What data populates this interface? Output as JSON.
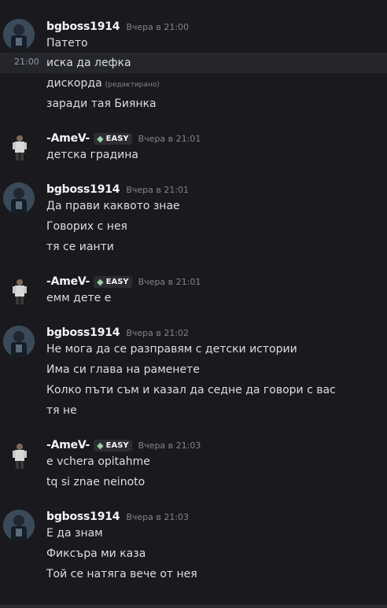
{
  "messages": [
    {
      "user": "bgboss1914",
      "time": "Вчера в 21:00",
      "lines": [
        "Патето",
        "иска да лефка",
        "дискорда",
        "заради тая Биянка"
      ],
      "edited_label": "(редактирано)"
    },
    {
      "user": "-AmeV-",
      "tag": "EASY",
      "time": "Вчера в 21:01",
      "lines": [
        "детска градина"
      ]
    },
    {
      "user": "bgboss1914",
      "time": "Вчера в 21:01",
      "lines": [
        "Да прави каквото знае",
        "Говорих с нея",
        "тя се ианти"
      ]
    },
    {
      "user": "-AmeV-",
      "tag": "EASY",
      "time": "Вчера в 21:01",
      "lines": [
        "емм дете е"
      ]
    },
    {
      "user": "bgboss1914",
      "time": "Вчера в 21:02",
      "lines": [
        "Не мога да се разправям с детски истории",
        "Има си глава на раменете",
        "Колко пъти съм и казал да седне да говори с вас",
        "тя не"
      ]
    },
    {
      "user": "-AmeV-",
      "tag": "EASY",
      "time": "Вчера в 21:03",
      "lines": [
        "e vchera opitahme",
        "tq si znae neinoto"
      ]
    },
    {
      "user": "bgboss1914",
      "time": "Вчера в 21:03",
      "lines": [
        "Е да знам",
        "Фиксъра ми каза",
        "Той се натяга вече от нея"
      ]
    }
  ],
  "hover_time": "21:00",
  "colors": {
    "background": "#1a1a1e",
    "text": "#dbdee1",
    "username": "#f2f3f5",
    "timestamp": "#80848e"
  },
  "icons": {
    "tag_icon": "gem-icon"
  }
}
